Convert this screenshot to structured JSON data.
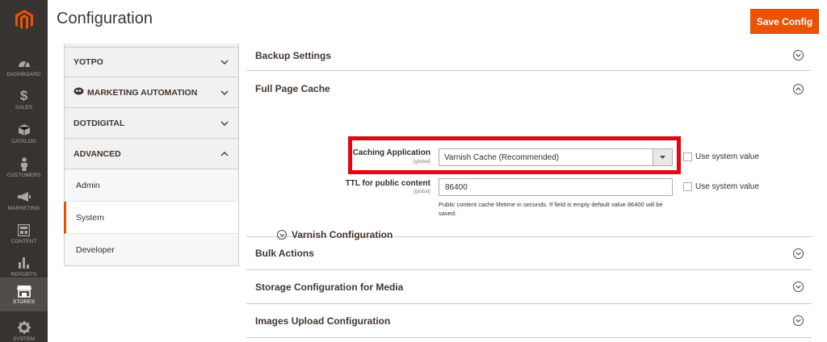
{
  "menu": {
    "items": [
      {
        "label": "DASHBOARD",
        "icon": "dashboard-icon"
      },
      {
        "label": "SALES",
        "icon": "dollar-icon"
      },
      {
        "label": "CATALOG",
        "icon": "box-icon"
      },
      {
        "label": "CUSTOMERS",
        "icon": "person-icon"
      },
      {
        "label": "MARKETING",
        "icon": "megaphone-icon"
      },
      {
        "label": "CONTENT",
        "icon": "layout-icon"
      },
      {
        "label": "REPORTS",
        "icon": "bar-chart-icon"
      },
      {
        "label": "STORES",
        "icon": "store-icon",
        "active": true
      },
      {
        "label": "SYSTEM",
        "icon": "gear-icon"
      }
    ]
  },
  "header": {
    "title": "Configuration",
    "save_label": "Save Config"
  },
  "tabs": {
    "groups": [
      {
        "label": "YOTPO",
        "expanded": false
      },
      {
        "label": "MARKETING AUTOMATION",
        "expanded": false,
        "icon": "dotmailer-icon"
      },
      {
        "label": "DOTDIGITAL",
        "expanded": false
      },
      {
        "label": "ADVANCED",
        "expanded": true
      }
    ],
    "links": [
      {
        "label": "Admin"
      },
      {
        "label": "System",
        "active": true
      },
      {
        "label": "Developer"
      }
    ]
  },
  "sections": {
    "backup": "Backup Settings",
    "full_page_cache": "Full Page Cache",
    "bulk_actions": "Bulk Actions",
    "storage_media": "Storage Configuration for Media",
    "images_upload": "Images Upload Configuration"
  },
  "fpc": {
    "caching_label": "Caching Application",
    "caching_scope": "[global]",
    "caching_value": "Varnish Cache (Recommended)",
    "ttl_label": "TTL for public content",
    "ttl_scope": "[global]",
    "ttl_value": "86400",
    "use_system_value": "Use system value",
    "ttl_note": "Public content cache lifetime in seconds. If field is empty default value 86400 will be saved.",
    "varnish_config": "Varnish Configuration"
  },
  "colors": {
    "accent": "#eb5202",
    "menu_bg": "#373330",
    "highlight_box": "#e30613"
  }
}
